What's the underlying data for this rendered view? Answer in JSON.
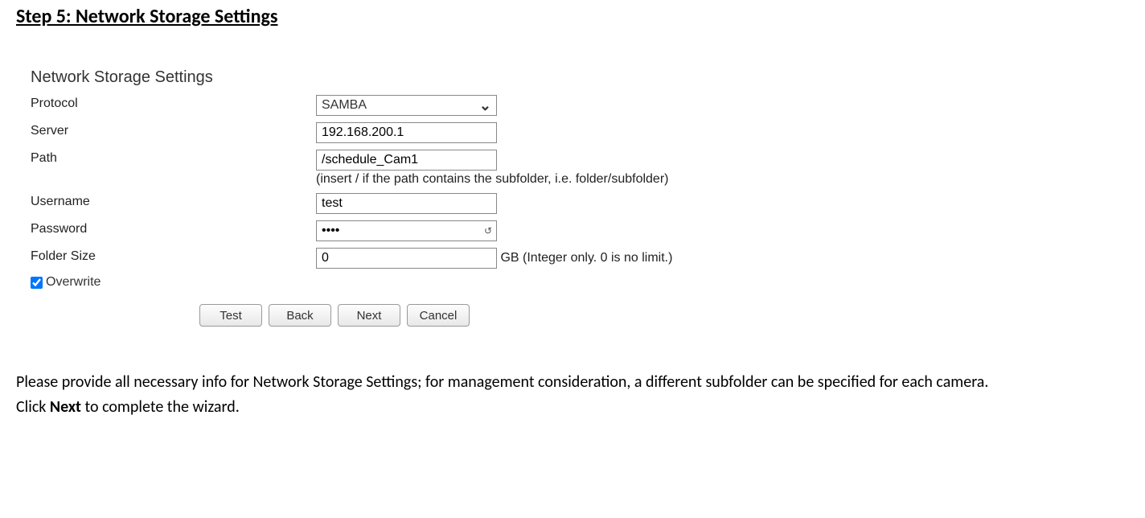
{
  "step_title": "Step 5: Network Storage Settings",
  "panel_title": "Network Storage Settings",
  "labels": {
    "protocol": "Protocol",
    "server": "Server",
    "path": "Path",
    "username": "Username",
    "password": "Password",
    "folder_size": "Folder Size",
    "overwrite": "Overwrite"
  },
  "values": {
    "protocol": "SAMBA",
    "server": "192.168.200.1",
    "path": "/schedule_Cam1",
    "username": "test",
    "password": "••••",
    "folder_size": "0"
  },
  "hints": {
    "path": "(insert / if the path contains the subfolder, i.e. folder/subfolder)",
    "folder_size": "GB (Integer only. 0 is no limit.)"
  },
  "buttons": {
    "test": "Test",
    "back": "Back",
    "next": "Next",
    "cancel": "Cancel"
  },
  "instructions": {
    "line1": "Please provide all necessary info for Network Storage Settings; for management consideration, a different subfolder can be specified for each camera.",
    "line2_prefix": "Click ",
    "line2_bold": "Next",
    "line2_suffix": " to complete the wizard."
  }
}
